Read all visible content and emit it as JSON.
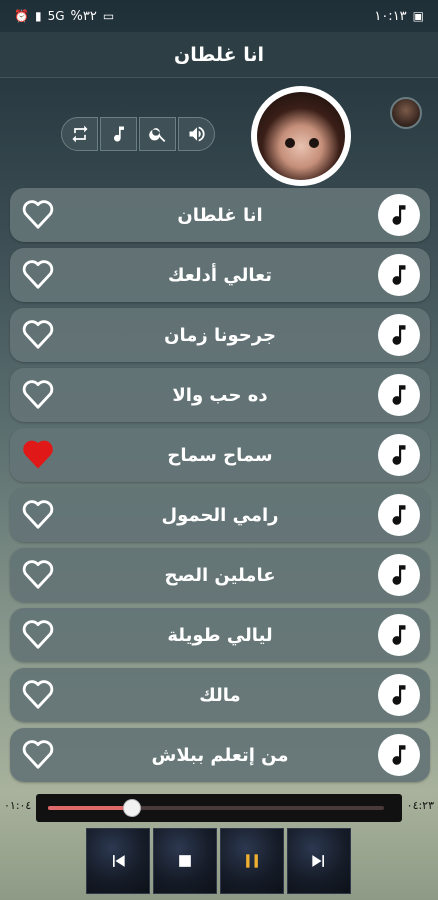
{
  "status_bar": {
    "left_text": "%٣٢",
    "signal": "5G",
    "time": "١٠:١٣",
    "icons": [
      "alarm-icon",
      "signal-icon",
      "battery-icon",
      "sim-icon"
    ]
  },
  "header": {
    "title": "انا غلطان"
  },
  "toolbar": {
    "buttons": [
      "repeat-icon",
      "music-note-icon",
      "search-icon",
      "volume-icon"
    ]
  },
  "songs": [
    {
      "title": "انا غلطان",
      "favorite": false
    },
    {
      "title": "تعالي أدلعك",
      "favorite": false
    },
    {
      "title": "جرحونا زمان",
      "favorite": false
    },
    {
      "title": "ده حب والا",
      "favorite": false
    },
    {
      "title": "سماح سماح",
      "favorite": true
    },
    {
      "title": "رامي الحمول",
      "favorite": false
    },
    {
      "title": "عاملين الصح",
      "favorite": false
    },
    {
      "title": "ليالي طويلة",
      "favorite": false
    },
    {
      "title": "مالك",
      "favorite": false
    },
    {
      "title": "من إتعلم ببلاش",
      "favorite": false
    }
  ],
  "player": {
    "elapsed": "٠١:٠٤",
    "total": "٠٤:٢٣",
    "progress": 0.25,
    "buttons": [
      "previous-icon",
      "stop-icon",
      "pause-icon",
      "next-icon"
    ],
    "colors": {
      "accent": "#e06a6a",
      "pause": "#f0b030",
      "heart_active": "#e01818"
    }
  }
}
